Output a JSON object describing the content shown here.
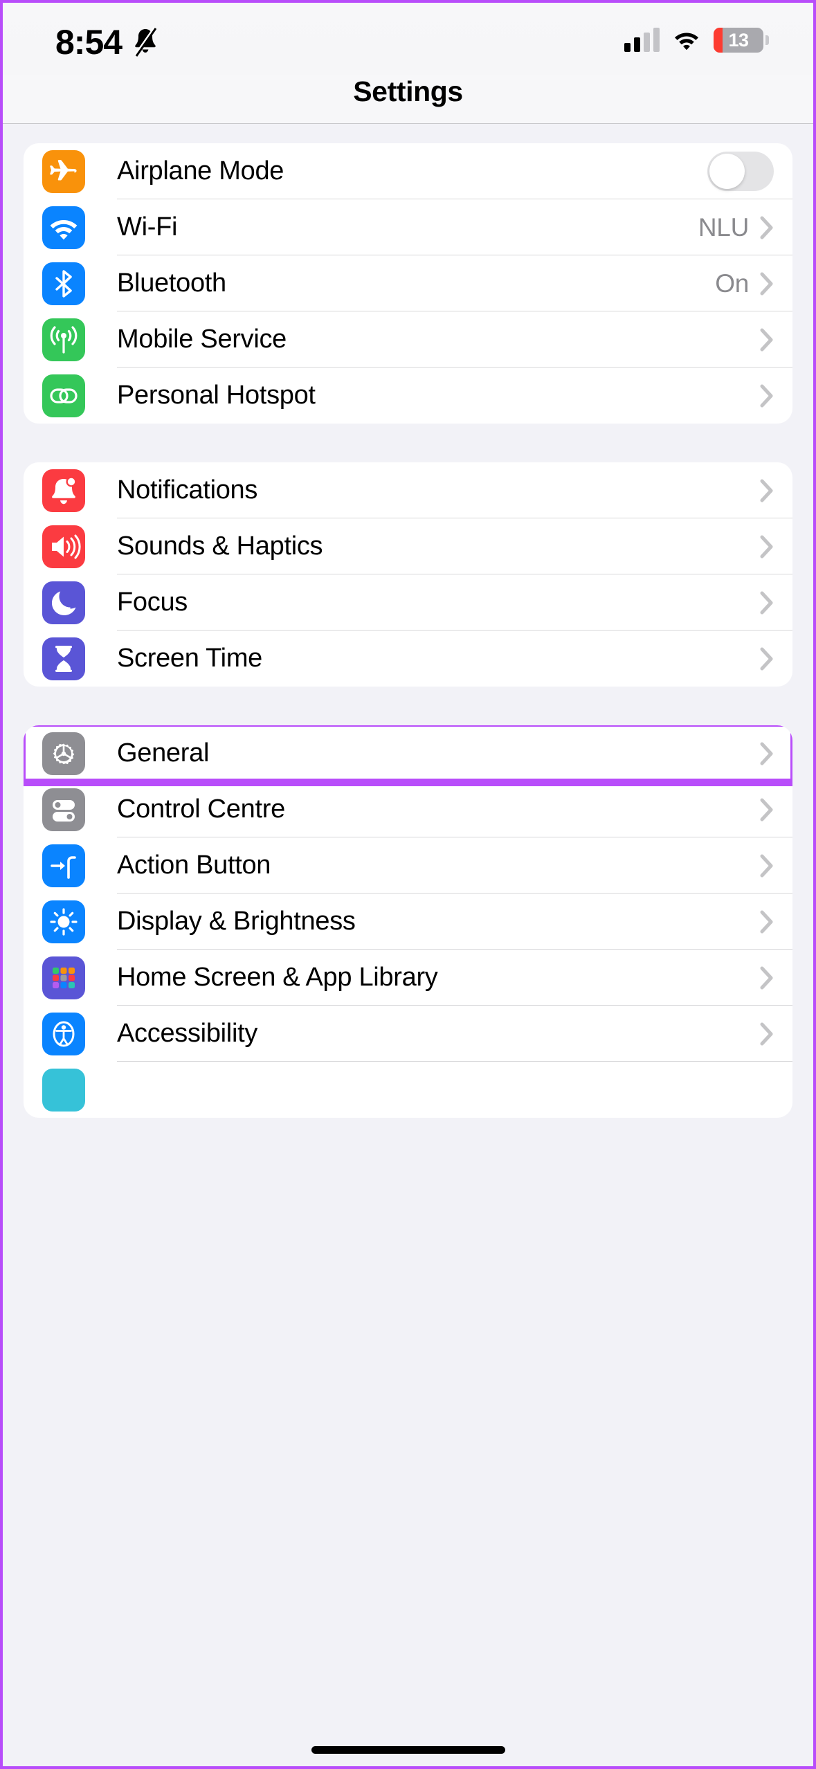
{
  "status_bar": {
    "time": "8:54",
    "bell_icon": "bell-slash-icon",
    "signal_icon": "cellular-signal-icon",
    "wifi_icon": "wifi-icon",
    "battery_level": "13",
    "battery_color": "#fd3b30"
  },
  "nav": {
    "title": "Settings"
  },
  "highlight": {
    "color": "#b84dfa",
    "target": "General"
  },
  "groups": [
    {
      "rows": [
        {
          "label": "Airplane Mode",
          "icon": "airplane-icon",
          "icon_color": "#f9920b",
          "control": "toggle",
          "toggle_on": false
        },
        {
          "label": "Wi-Fi",
          "icon": "wifi-icon",
          "icon_color": "#0a84ff",
          "value": "NLU",
          "control": "chevron"
        },
        {
          "label": "Bluetooth",
          "icon": "bluetooth-icon",
          "icon_color": "#0a84ff",
          "value": "On",
          "control": "chevron"
        },
        {
          "label": "Mobile Service",
          "icon": "antenna-icon",
          "icon_color": "#34c759",
          "value": "",
          "control": "chevron"
        },
        {
          "label": "Personal Hotspot",
          "icon": "link-icon",
          "icon_color": "#34c759",
          "value": "",
          "control": "chevron"
        }
      ]
    },
    {
      "rows": [
        {
          "label": "Notifications",
          "icon": "bell-badge-icon",
          "icon_color": "#fb3b41",
          "value": "",
          "control": "chevron"
        },
        {
          "label": "Sounds & Haptics",
          "icon": "speaker-waves-icon",
          "icon_color": "#fb3b41",
          "value": "",
          "control": "chevron"
        },
        {
          "label": "Focus",
          "icon": "moon-icon",
          "icon_color": "#5a55d6",
          "value": "",
          "control": "chevron"
        },
        {
          "label": "Screen Time",
          "icon": "hourglass-icon",
          "icon_color": "#5a55d6",
          "value": "",
          "control": "chevron"
        }
      ]
    },
    {
      "rows": [
        {
          "label": "General",
          "icon": "gear-icon",
          "icon_color": "#8e8e93",
          "value": "",
          "control": "chevron",
          "highlighted": true
        },
        {
          "label": "Control Centre",
          "icon": "sliders-icon",
          "icon_color": "#8e8e93",
          "value": "",
          "control": "chevron"
        },
        {
          "label": "Action Button",
          "icon": "action-button-icon",
          "icon_color": "#0a84ff",
          "value": "",
          "control": "chevron"
        },
        {
          "label": "Display & Brightness",
          "icon": "brightness-icon",
          "icon_color": "#0a84ff",
          "value": "",
          "control": "chevron"
        },
        {
          "label": "Home Screen & App Library",
          "icon": "app-grid-icon",
          "icon_color": "#5a55d6",
          "value": "",
          "control": "chevron"
        },
        {
          "label": "Accessibility",
          "icon": "accessibility-icon",
          "icon_color": "#0a84ff",
          "value": "",
          "control": "chevron"
        }
      ]
    }
  ]
}
